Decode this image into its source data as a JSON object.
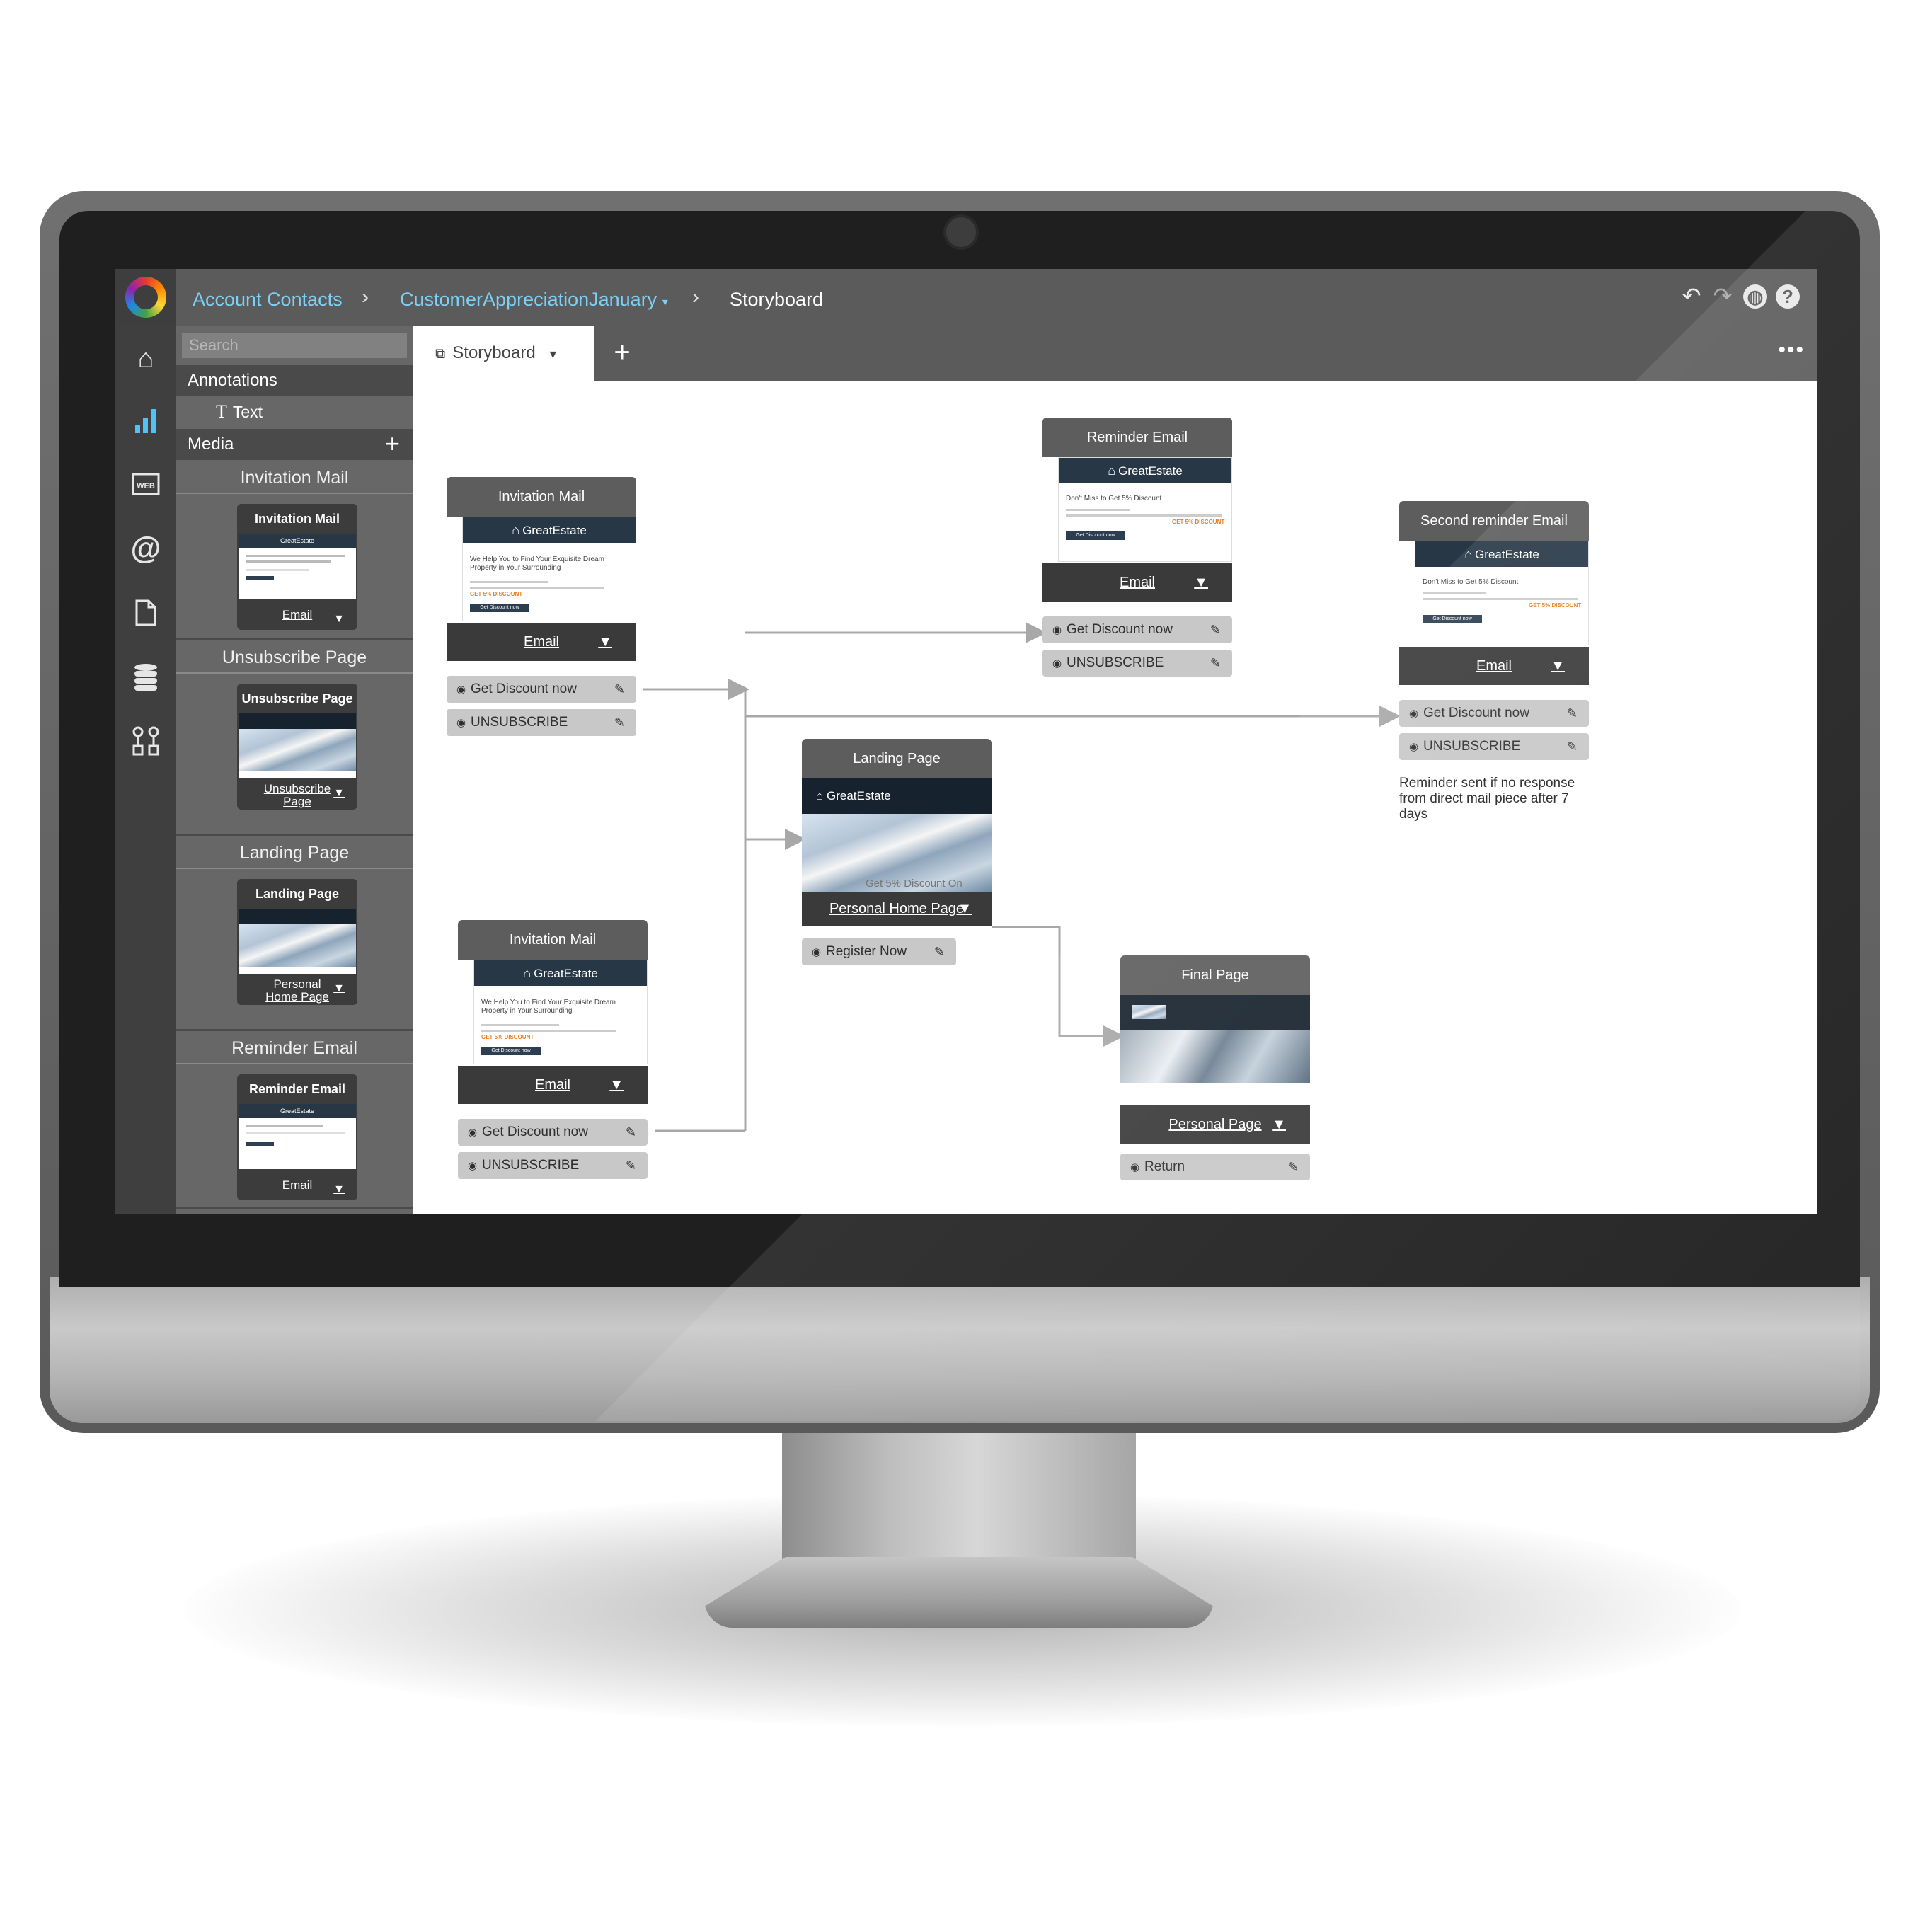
{
  "breadcrumb": {
    "item1": "Account Contacts",
    "item2": "CustomerAppreciationJanuary",
    "item3": "Storyboard"
  },
  "tabs": {
    "active": "Storyboard"
  },
  "sidebar": {
    "search_placeholder": "Search",
    "annotations_header": "Annotations",
    "text_item": "Text",
    "media_header": "Media",
    "categories": [
      {
        "label": "Invitation Mail",
        "thumb_title": "Invitation Mail",
        "thumb_footer": "Email"
      },
      {
        "label": "Unsubscribe Page",
        "thumb_title": "Unsubscribe Page",
        "thumb_footer": "Unsubscribe Page"
      },
      {
        "label": "Landing Page",
        "thumb_title": "Landing Page",
        "thumb_footer": "Personal Home Page"
      },
      {
        "label": "Reminder Email",
        "thumb_title": "Reminder Email",
        "thumb_footer": "Email"
      }
    ]
  },
  "email_preview": {
    "brand": "GreatEstate",
    "headline": "We Help You to Find Your Exquisite Dream Property in Your Surrounding",
    "reminder_headline": "Don't Miss to Get 5% Discount",
    "discount": "GET 5% DISCOUNT",
    "button": "Get Discount now"
  },
  "nodes": {
    "invitation1": {
      "title": "Invitation Mail",
      "footer": "Email",
      "links": [
        "Get Discount now",
        "UNSUBSCRIBE"
      ]
    },
    "invitation2": {
      "title": "Invitation Mail",
      "footer": "Email",
      "links": [
        "Get Discount now",
        "UNSUBSCRIBE"
      ]
    },
    "reminder": {
      "title": "Reminder Email",
      "footer": "Email",
      "links": [
        "Get Discount now",
        "UNSUBSCRIBE"
      ]
    },
    "second_reminder": {
      "title": "Second reminder Email",
      "footer": "Email",
      "links": [
        "Get Discount now",
        "UNSUBSCRIBE"
      ],
      "note": "Reminder sent if no response from direct mail piece after 7 days"
    },
    "landing": {
      "title": "Landing Page",
      "footer": "Personal Home Page",
      "preview_text": "Get 5% Discount On",
      "links": [
        "Register Now"
      ]
    },
    "final": {
      "title": "Final Page",
      "footer": "Personal Page",
      "links": [
        "Return"
      ]
    }
  },
  "colors": {
    "topbar": "#5b5b5b",
    "link": "#7dd0f4",
    "node_header": "#5d5d5d",
    "node_footer": "#3a3a3a",
    "node_link": "#c8c8c8",
    "brand_banner": "#273746",
    "discount": "#e67e22"
  },
  "icons": {
    "nav": [
      "home-icon",
      "analytics-icon",
      "web-icon",
      "at-icon",
      "document-icon",
      "database-icon",
      "workflow-icon"
    ],
    "top": [
      "undo-icon",
      "redo-icon",
      "globe-icon",
      "help-icon"
    ]
  }
}
